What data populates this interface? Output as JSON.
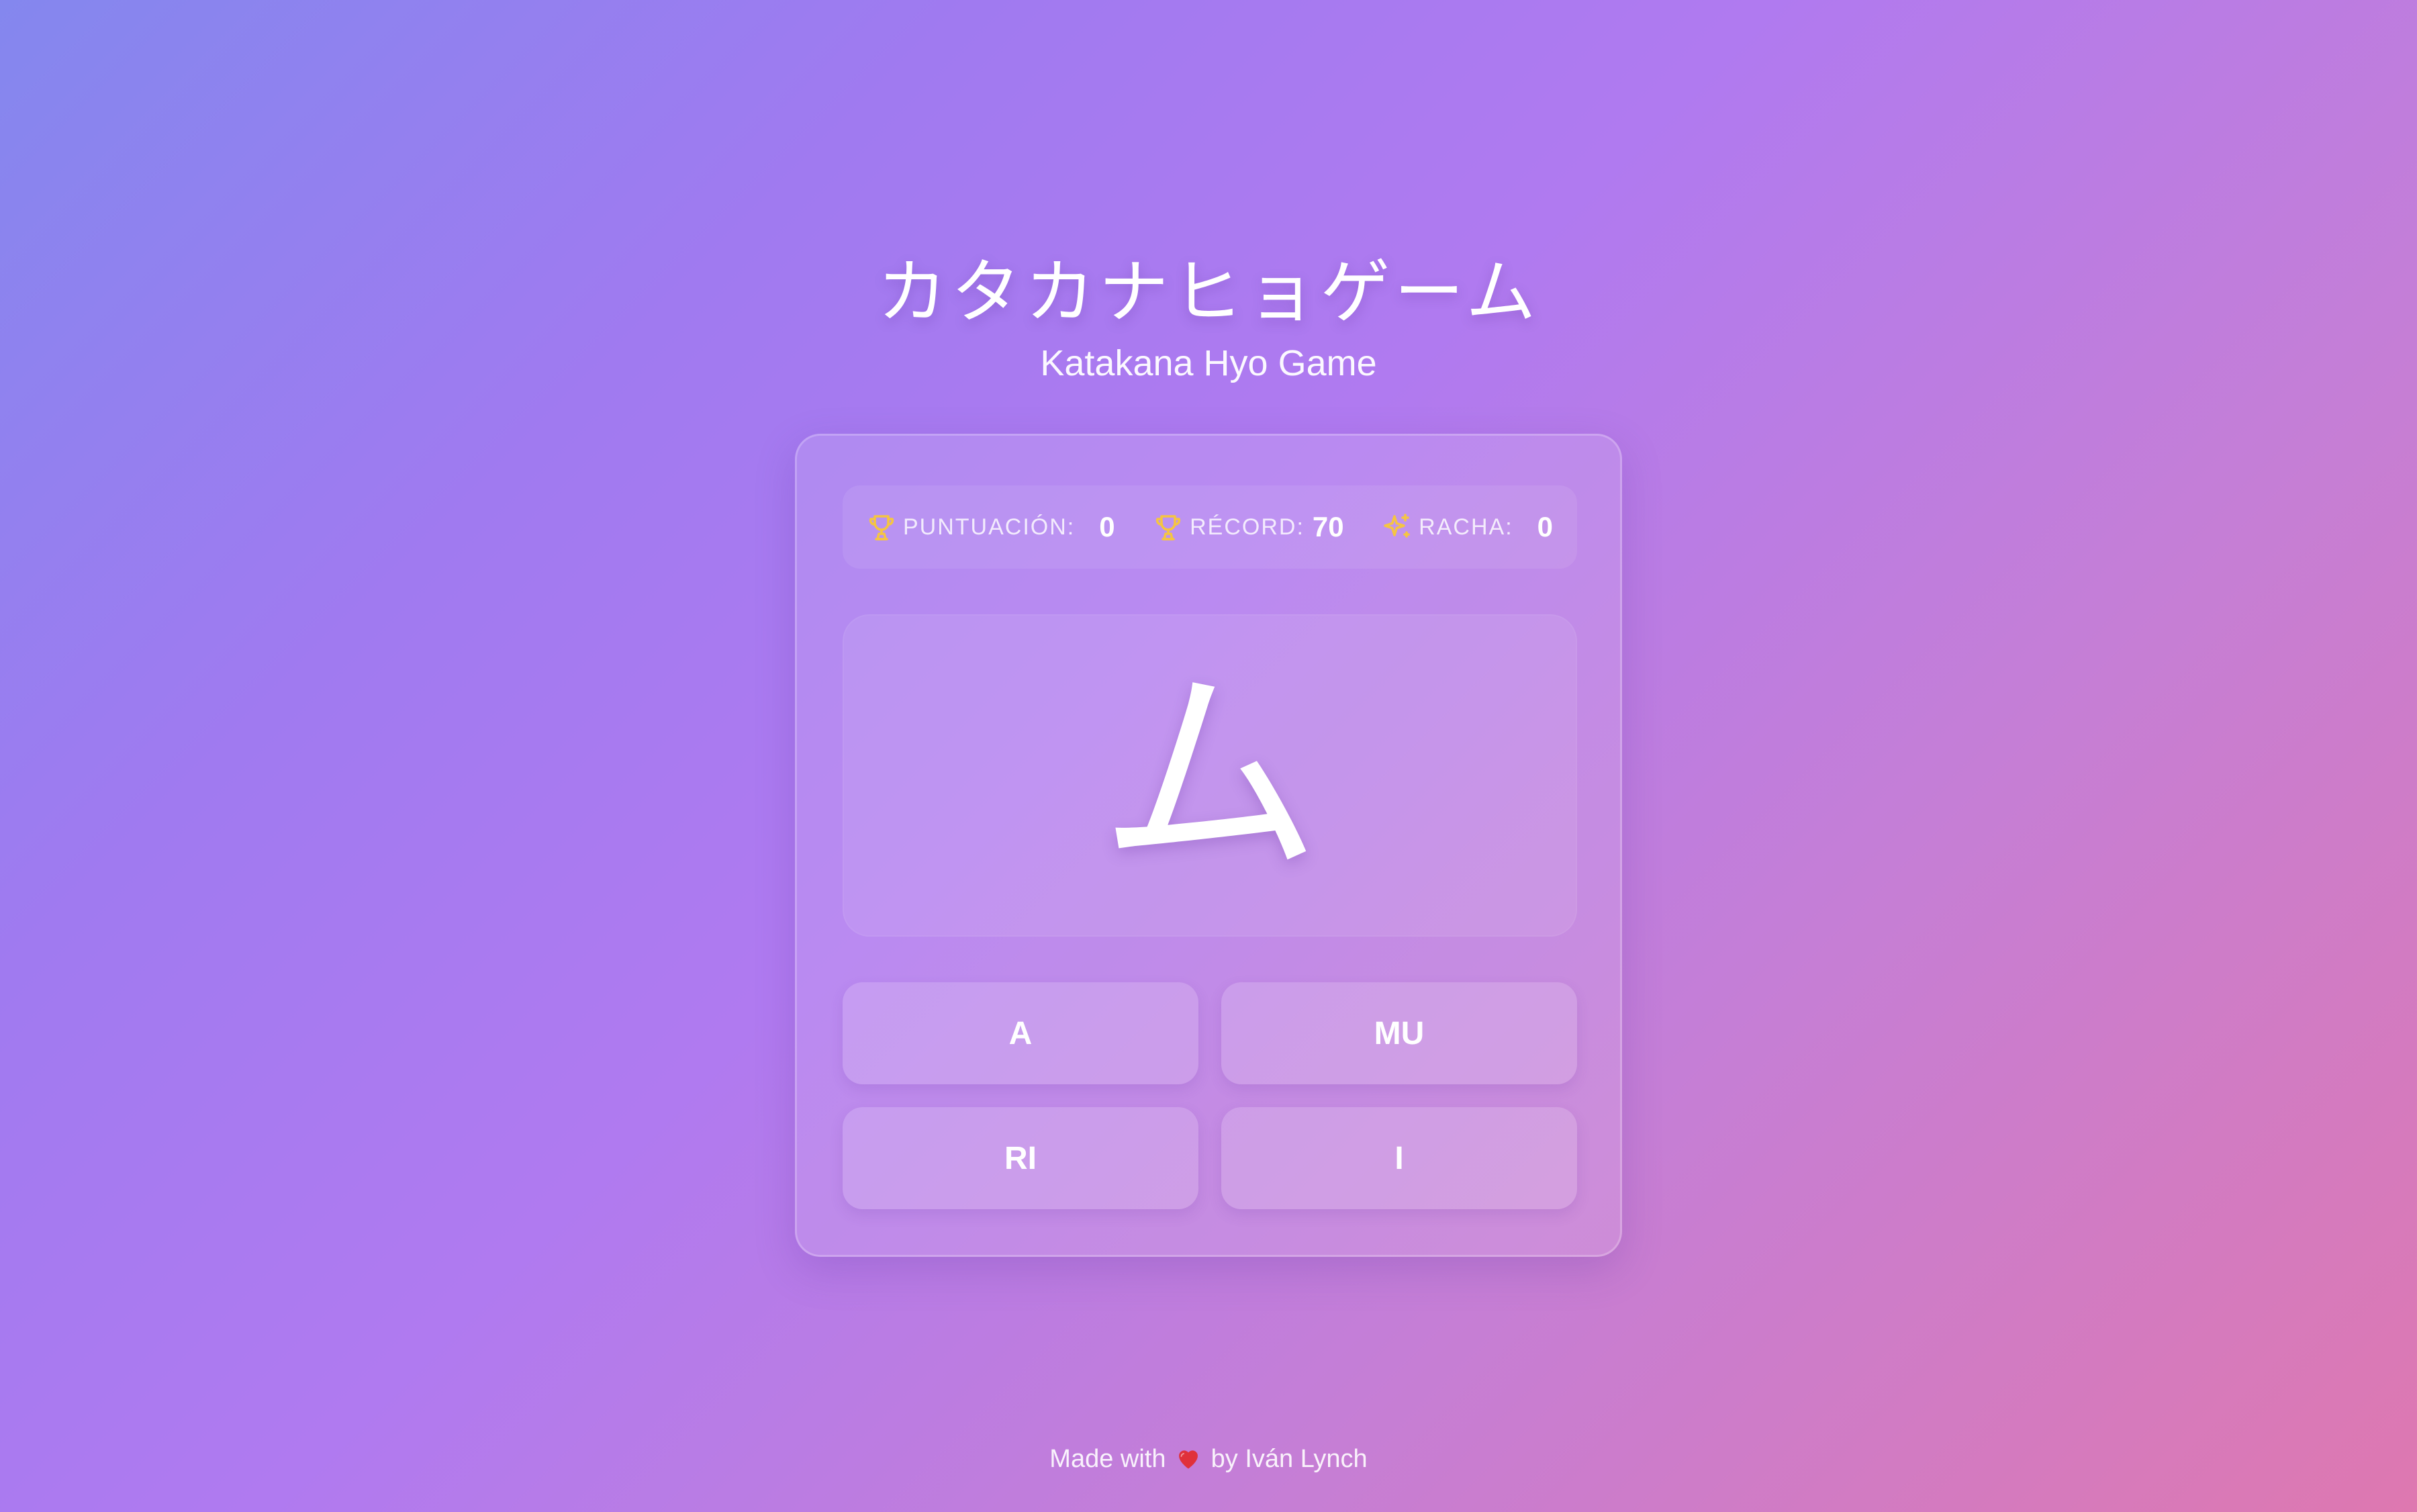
{
  "header": {
    "title": "カタカナヒョゲーム",
    "subtitle": "Katakana Hyo Game"
  },
  "stats": {
    "score_label": "PUNTUACIÓN:",
    "score_value": "0",
    "record_label": "RÉCORD:",
    "record_value": "70",
    "streak_label": "RACHA:",
    "streak_value": "0"
  },
  "game": {
    "current_character": "ム",
    "options": [
      "A",
      "MU",
      "RI",
      "I"
    ]
  },
  "footer": {
    "prefix": "Made with",
    "suffix": "by Iván Lynch"
  },
  "icons": {
    "score": "trophy-icon",
    "record": "trophy-icon",
    "streak": "sparkles-icon",
    "footer": "heart-icon"
  },
  "colors": {
    "icon_gold": "#f5c542",
    "heart_red": "#e0313a"
  }
}
